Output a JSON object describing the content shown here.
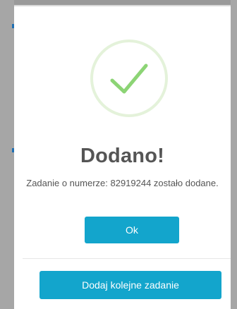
{
  "dialog": {
    "icon": "success-checkmark-icon",
    "title": "Dodano!",
    "message": "Zadanie o numerze: 82919244 zostało dodane.",
    "ok_label": "Ok",
    "add_next_label": "Dodaj kolejne zadanie"
  },
  "colors": {
    "accent": "#13a5cc",
    "success_ring": "#e4f2da",
    "success_check": "#8cd475",
    "title_text": "#555555",
    "backdrop": "#9a9a9a"
  }
}
